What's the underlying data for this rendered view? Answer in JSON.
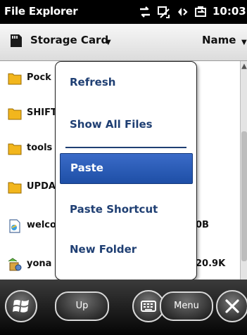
{
  "status_bar": {
    "app_title": "File Explorer",
    "clock": "10:03",
    "icons": [
      "connectivity-icon",
      "signal-icon",
      "volume-icon",
      "battery-charging-icon"
    ]
  },
  "location_bar": {
    "location": "Storage Card",
    "sort_by": "Name"
  },
  "files": [
    {
      "name": "Pock",
      "size": "",
      "icon": "folder-icon"
    },
    {
      "name": "SHIFT",
      "size": "",
      "icon": "folder-icon"
    },
    {
      "name": "tools",
      "size": "",
      "icon": "folder-icon"
    },
    {
      "name": "UPDA",
      "size": "",
      "icon": "folder-icon"
    },
    {
      "name": "welco",
      "size": "0B",
      "icon": "document-icon"
    },
    {
      "name": "yona",
      "size": "20.9K",
      "icon": "setup-file-icon"
    }
  ],
  "context_menu": {
    "items": [
      {
        "label": "Refresh",
        "selected": false
      },
      {
        "label": "Show All Files",
        "selected": false
      },
      {
        "label": "Paste",
        "selected": true
      },
      {
        "label": "Paste Shortcut",
        "selected": false
      },
      {
        "label": "New Folder",
        "selected": false
      }
    ]
  },
  "toolbar": {
    "up_label": "Up",
    "menu_label": "Menu",
    "icons": [
      "start-icon",
      "keyboard-icon",
      "close-icon"
    ]
  },
  "colors": {
    "menu_text": "#1f3f73",
    "menu_selected": "#2a5bb8",
    "status_bar_bg": "#000000",
    "toolbar_bg": "#1a1a1a"
  }
}
